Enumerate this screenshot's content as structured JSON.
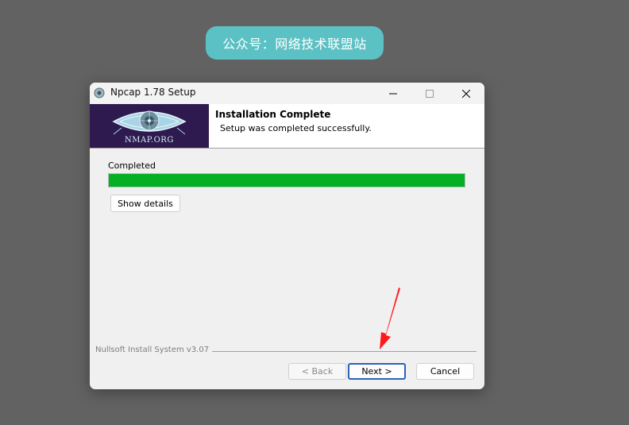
{
  "watermark": {
    "text": "公众号：网络技术联盟站"
  },
  "window": {
    "title": "Npcap 1.78 Setup",
    "controls": {
      "minimize": "—",
      "maximize": "☐",
      "close": "✕"
    }
  },
  "header": {
    "logo_text": "NMAP.ORG",
    "title": "Installation Complete",
    "subtitle": "Setup was completed successfully."
  },
  "body": {
    "status_label": "Completed",
    "progress_percent": 100,
    "progress_color": "#06b025",
    "show_details_label": "Show details"
  },
  "footer": {
    "branding": "Nullsoft Install System v3.07",
    "back_label": "< Back",
    "next_label": "Next >",
    "cancel_label": "Cancel"
  },
  "annotation": {
    "arrow_color": "#ff1a1a"
  }
}
